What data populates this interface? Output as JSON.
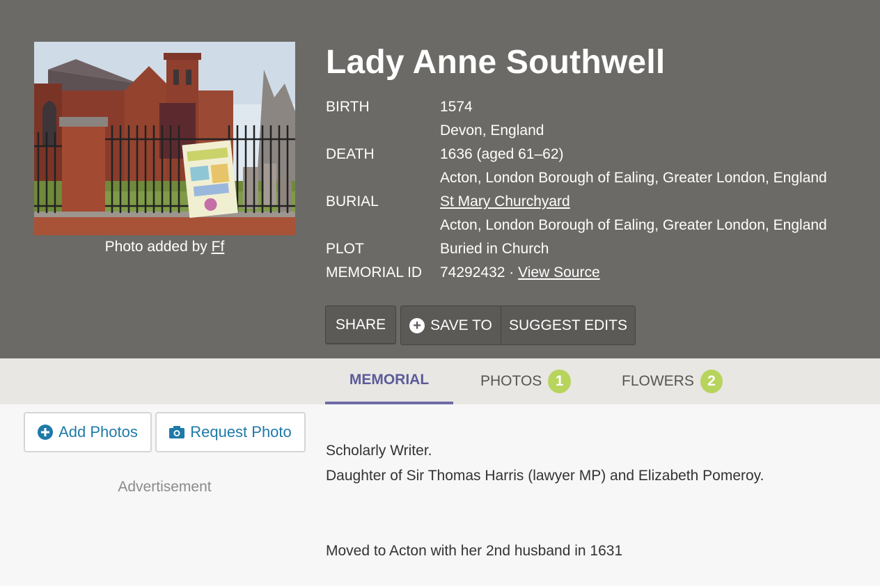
{
  "header": {
    "name": "Lady Anne Southwell",
    "photo_credit_prefix": "Photo added by",
    "photo_credit_user": "Ff"
  },
  "facts": {
    "birth_label": "BIRTH",
    "birth_date": "1574",
    "birth_place": "Devon, England",
    "death_label": "DEATH",
    "death_date": "1636 (aged 61–62)",
    "death_place": "Acton, London Borough of Ealing, Greater London, England",
    "burial_label": "BURIAL",
    "burial_cemetery": "St Mary Churchyard",
    "burial_place": "Acton, London Borough of Ealing, Greater London, England",
    "plot_label": "PLOT",
    "plot_value": "Buried in Church",
    "memorial_label": "MEMORIAL ID",
    "memorial_id": "74292432",
    "memorial_sep": " · ",
    "view_source": "View Source"
  },
  "actions": {
    "share": "SHARE",
    "save_to": "SAVE TO",
    "suggest_edits": "SUGGEST EDITS"
  },
  "tabs": [
    {
      "label": "MEMORIAL"
    },
    {
      "label": "PHOTOS",
      "count": "1"
    },
    {
      "label": "FLOWERS",
      "count": "2"
    }
  ],
  "sidebar": {
    "add_photos": "Add Photos",
    "request_photo": "Request Photo",
    "advertisement": "Advertisement"
  },
  "bio": {
    "line1": "Scholarly Writer.",
    "line2": "Daughter of Sir Thomas Harris (lawyer MP) and Elizabeth Pomeroy.",
    "line3": "Moved to Acton with her 2nd husband in 1631"
  },
  "colors": {
    "hero_bg": "#6b6a66",
    "tab_active": "#5d5b9a",
    "badge": "#b7d45c",
    "link_blue": "#1e7aa8"
  }
}
